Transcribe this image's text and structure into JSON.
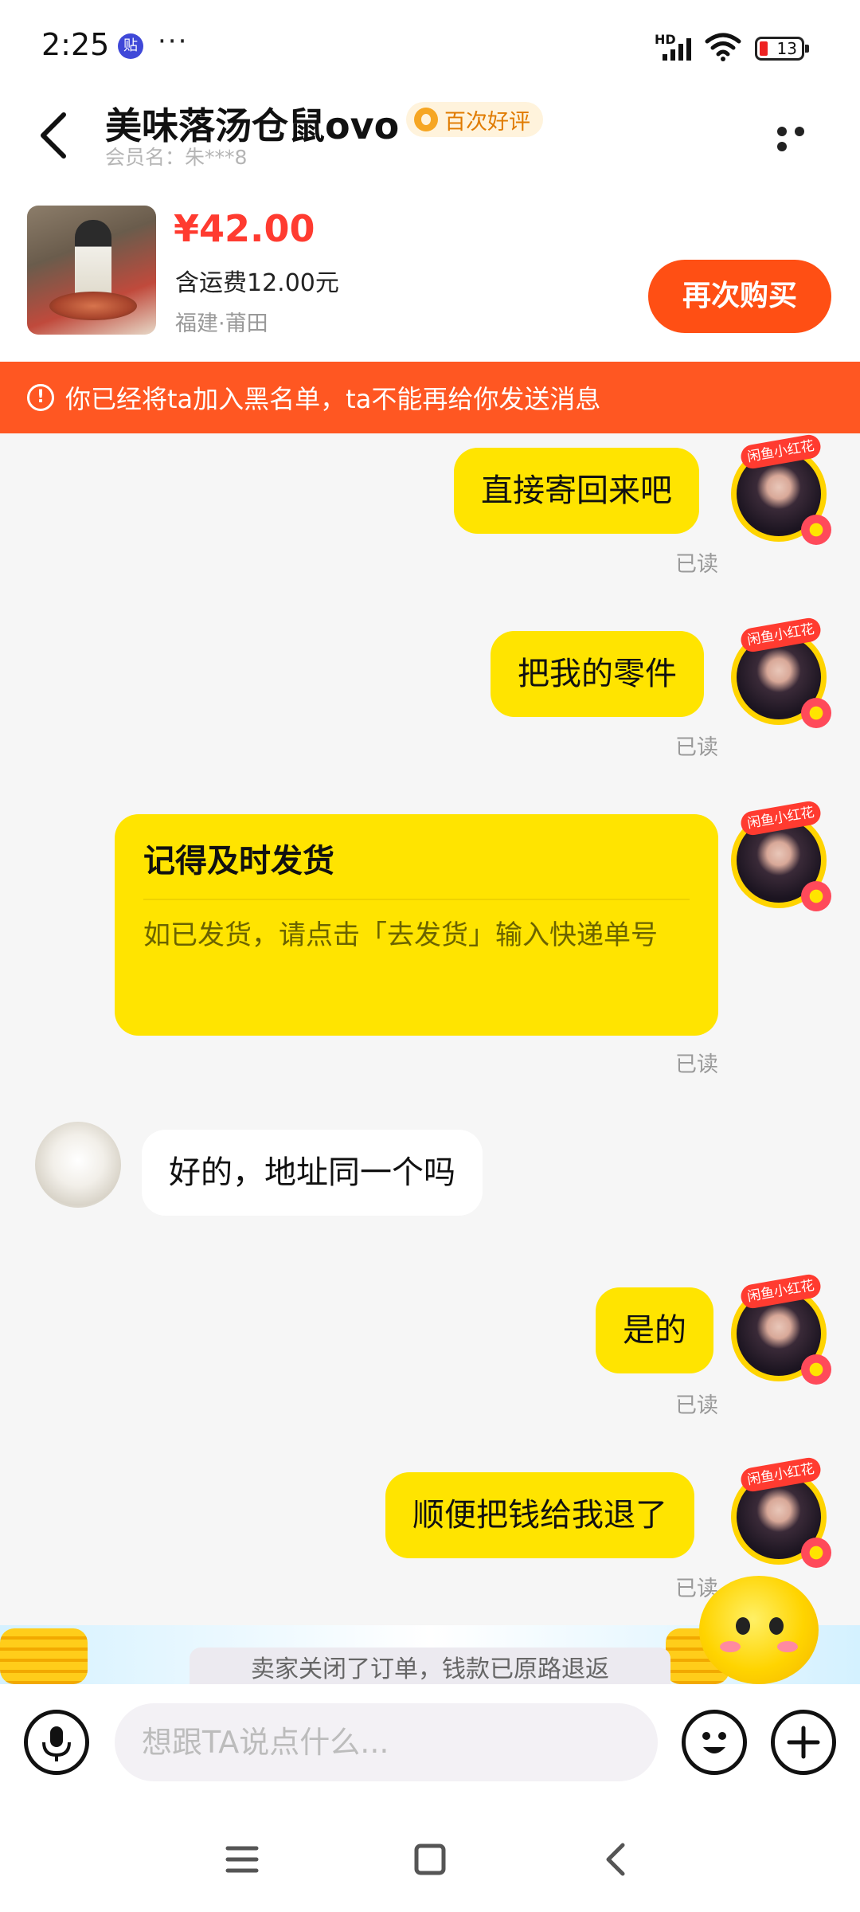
{
  "status_bar": {
    "time": "2:25",
    "app_badge": "贴",
    "more_dots": "···",
    "network": "HD",
    "battery": "13"
  },
  "header": {
    "title": "美味落汤仓鼠ovo",
    "rating_badge": "百次好评",
    "member_label": "会员名：朱***8"
  },
  "product": {
    "price": "¥42.00",
    "shipping": "含运费12.00元",
    "location": "福建·莆田",
    "rebuy_label": "再次购买"
  },
  "banner": {
    "icon": "!",
    "text": "你已经将ta加入黑名单，ta不能再给你发送消息"
  },
  "avatar_tag": "闲鱼小红花",
  "messages": [
    {
      "from": "me",
      "text": "直接寄回来吧",
      "status": "已读"
    },
    {
      "from": "me",
      "text": "把我的零件",
      "status": "已读"
    },
    {
      "from": "me",
      "type": "card",
      "title": "记得及时发货",
      "body": "如已发货，请点击「去发货」输入快递单号",
      "status": "已读"
    },
    {
      "from": "other",
      "text": "好的，地址同一个吗"
    },
    {
      "from": "me",
      "text": "是的",
      "status": "已读"
    },
    {
      "from": "me",
      "text": "顺便把钱给我退了",
      "status": "已读"
    }
  ],
  "system_notice": "卖家关闭了订单，钱款已原路退返",
  "input": {
    "placeholder": "想跟TA说点什么..."
  },
  "colors": {
    "accent": "#ffe400",
    "banner": "#ff5722",
    "button": "#ff4f14",
    "price": "#ff3b30"
  },
  "icons": [
    "back-arrow-icon",
    "more-icon",
    "warning-icon",
    "mic-icon",
    "emoji-icon",
    "plus-icon",
    "menu-icon",
    "home-icon",
    "back-nav-icon"
  ]
}
